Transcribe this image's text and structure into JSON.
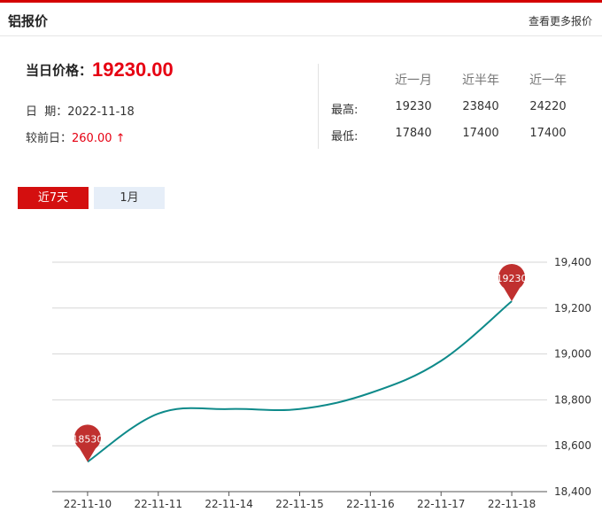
{
  "header": {
    "title": "铝报价",
    "more_link": "查看更多报价"
  },
  "summary": {
    "price_label": "当日价格：",
    "price_value": "19230.00",
    "date_label": "日  期：",
    "date_value": "2022-11-18",
    "diff_label": "较前日：",
    "diff_value": "260.00",
    "diff_arrow": "↑"
  },
  "stats": {
    "columns": [
      "近一月",
      "近半年",
      "近一年"
    ],
    "rows": [
      {
        "label": "最高:",
        "values": [
          "19230",
          "23840",
          "24220"
        ]
      },
      {
        "label": "最低:",
        "values": [
          "17840",
          "17400",
          "17400"
        ]
      }
    ]
  },
  "tabs": [
    {
      "label": "近7天",
      "active": true
    },
    {
      "label": "1月",
      "active": false
    }
  ],
  "colors": {
    "accent": "#d40000",
    "price_red": "#e60012",
    "line": "#0e8a8a",
    "marker": "#c0302f"
  },
  "chart_data": {
    "type": "line",
    "categories": [
      "22-11-10",
      "22-11-11",
      "22-11-14",
      "22-11-15",
      "22-11-16",
      "22-11-17",
      "22-11-18"
    ],
    "series": [
      {
        "values": [
          18530,
          18740,
          18760,
          18760,
          18830,
          18970,
          19230
        ]
      }
    ],
    "yticks": [
      "18,400",
      "18,600",
      "18,800",
      "19,000",
      "19,200",
      "19,400"
    ],
    "ylim": [
      18400,
      19400
    ],
    "grid": true,
    "markers": [
      {
        "index": 0,
        "label": "18530"
      },
      {
        "index": 6,
        "label": "19230"
      }
    ]
  }
}
